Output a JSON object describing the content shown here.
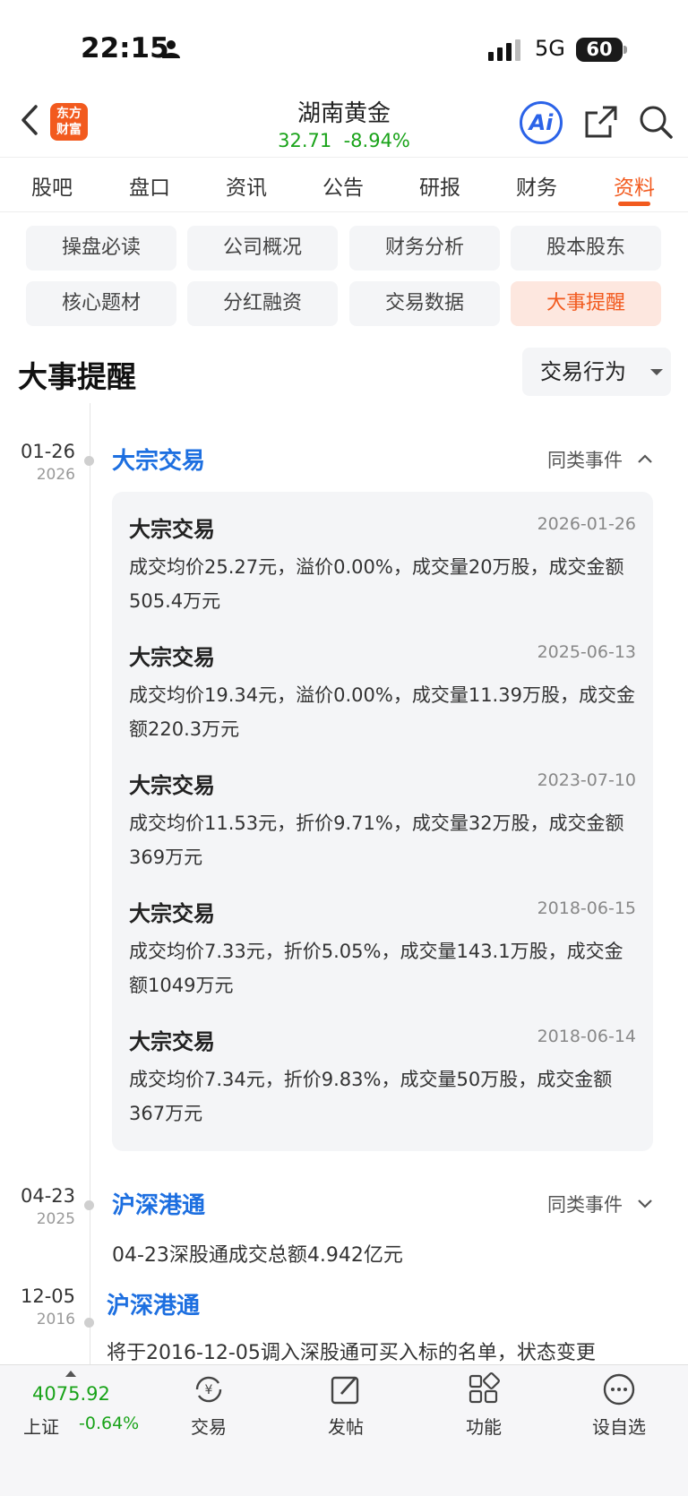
{
  "status": {
    "time": "22:15",
    "network": "5G",
    "battery": "60"
  },
  "header": {
    "logo_line1": "东方",
    "logo_line2": "财富",
    "stock_name": "湖南黄金",
    "price": "32.71",
    "change": "-8.94%",
    "ai_label": "Ai",
    "quote_color": "#19a319"
  },
  "tabs": [
    "股吧",
    "盘口",
    "资讯",
    "公告",
    "研报",
    "财务",
    "资料"
  ],
  "active_tab": "资料",
  "chips": [
    "操盘必读",
    "公司概况",
    "财务分析",
    "股本股东",
    "核心题材",
    "分红融资",
    "交易数据",
    "大事提醒"
  ],
  "active_chip": "大事提醒",
  "section": {
    "title": "大事提醒",
    "filter": "交易行为"
  },
  "events": [
    {
      "date": "01-26",
      "year": "2026",
      "title": "大宗交易",
      "similar": "同类事件",
      "expanded": true,
      "items": [
        {
          "title": "大宗交易",
          "date": "2026-01-26",
          "desc": "成交均价25.27元，溢价0.00%，成交量20万股，成交金额505.4万元"
        },
        {
          "title": "大宗交易",
          "date": "2025-06-13",
          "desc": "成交均价19.34元，溢价0.00%，成交量11.39万股，成交金额220.3万元"
        },
        {
          "title": "大宗交易",
          "date": "2023-07-10",
          "desc": "成交均价11.53元，折价9.71%，成交量32万股，成交金额369万元"
        },
        {
          "title": "大宗交易",
          "date": "2018-06-15",
          "desc": "成交均价7.33元，折价5.05%，成交量143.1万股，成交金额1049万元"
        },
        {
          "title": "大宗交易",
          "date": "2018-06-14",
          "desc": "成交均价7.34元，折价9.83%，成交量50万股，成交金额367万元"
        }
      ]
    },
    {
      "date": "04-23",
      "year": "2025",
      "title": "沪深港通",
      "similar": "同类事件",
      "expanded": false,
      "text": "04-23深股通成交总额4.942亿元"
    },
    {
      "date": "12-05",
      "year": "2016",
      "title": "沪深港通",
      "text": "将于2016-12-05调入深股通可买入标的名单，状态变更"
    }
  ],
  "bottom_bar": {
    "index_value": "4075.92",
    "index_name": "上证",
    "index_change": "-0.64%",
    "items": [
      {
        "label": "交易",
        "icon": "yuan-exchange-icon"
      },
      {
        "label": "发帖",
        "icon": "edit-icon"
      },
      {
        "label": "功能",
        "icon": "grid-icon"
      },
      {
        "label": "设自选",
        "icon": "more-icon"
      }
    ]
  },
  "colors": {
    "accent": "#f25a1e",
    "link": "#1d6fe0",
    "down": "#19a319",
    "ai": "#2b63e8"
  }
}
